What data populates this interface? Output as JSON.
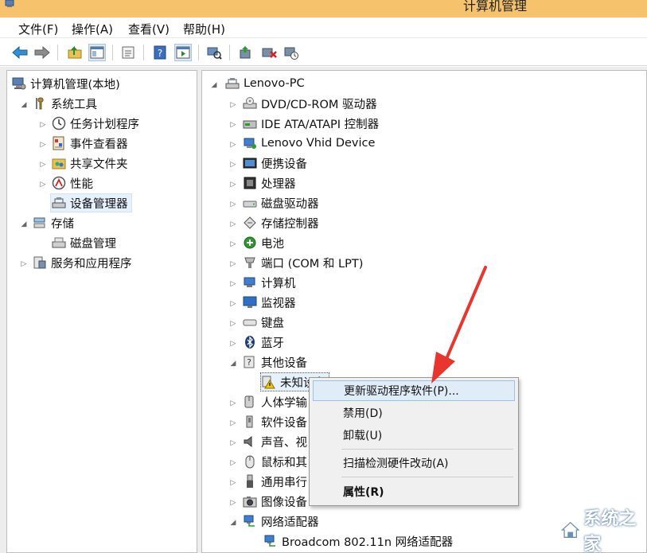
{
  "window": {
    "title": "计算机管理"
  },
  "menu": [
    "文件(F)",
    "操作(A)",
    "查看(V)",
    "帮助(H)"
  ],
  "left_tree": [
    {
      "label": "计算机管理(本地)",
      "icon": "computer-management-icon"
    },
    {
      "label": "系统工具",
      "icon": "tools-icon"
    },
    {
      "label": "任务计划程序",
      "icon": "clock-icon"
    },
    {
      "label": "事件查看器",
      "icon": "event-viewer-icon"
    },
    {
      "label": "共享文件夹",
      "icon": "shared-folder-icon"
    },
    {
      "label": "性能",
      "icon": "performance-icon"
    },
    {
      "label": "设备管理器",
      "icon": "device-manager-icon"
    },
    {
      "label": "存储",
      "icon": "storage-icon"
    },
    {
      "label": "磁盘管理",
      "icon": "disk-management-icon"
    },
    {
      "label": "服务和应用程序",
      "icon": "services-icon"
    }
  ],
  "right_tree": [
    {
      "label": "Lenovo-PC",
      "icon": "computer-icon"
    },
    {
      "label": "DVD/CD-ROM 驱动器",
      "icon": "dvd-icon"
    },
    {
      "label": "IDE ATA/ATAPI 控制器",
      "icon": "ide-icon"
    },
    {
      "label": "Lenovo Vhid Device",
      "icon": "hid-device-icon"
    },
    {
      "label": "便携设备",
      "icon": "portable-device-icon"
    },
    {
      "label": "处理器",
      "icon": "processor-icon"
    },
    {
      "label": "磁盘驱动器",
      "icon": "disk-drive-icon"
    },
    {
      "label": "存储控制器",
      "icon": "storage-controller-icon"
    },
    {
      "label": "电池",
      "icon": "battery-icon"
    },
    {
      "label": "端口 (COM 和 LPT)",
      "icon": "port-icon"
    },
    {
      "label": "计算机",
      "icon": "computer-icon"
    },
    {
      "label": "监视器",
      "icon": "monitor-icon"
    },
    {
      "label": "键盘",
      "icon": "keyboard-icon"
    },
    {
      "label": "蓝牙",
      "icon": "bluetooth-icon"
    },
    {
      "label": "其他设备",
      "icon": "other-devices-icon"
    },
    {
      "label": "未知设备",
      "icon": "unknown-device-warning-icon"
    },
    {
      "label": "人体学输",
      "icon": "hid-icon"
    },
    {
      "label": "软件设备",
      "icon": "software-device-icon"
    },
    {
      "label": "声音、视",
      "icon": "speaker-icon"
    },
    {
      "label": "鼠标和其",
      "icon": "mouse-icon"
    },
    {
      "label": "通用串行",
      "icon": "usb-icon"
    },
    {
      "label": "图像设备",
      "icon": "camera-icon"
    },
    {
      "label": "网络适配器",
      "icon": "network-adapter-icon"
    },
    {
      "label": "Broadcom 802.11n 网络适配器",
      "icon": "network-adapter-icon"
    }
  ],
  "context_menu": [
    {
      "label": "更新驱动程序软件(P)..."
    },
    {
      "label": "禁用(D)"
    },
    {
      "label": "卸载(U)"
    },
    {
      "label": "扫描检测硬件改动(A)"
    },
    {
      "label": "属性(R)"
    }
  ],
  "watermark": {
    "text": "系统之家"
  },
  "colors": {
    "titlebar": "#f6c26b",
    "selection": "#e5f1fb",
    "arrow": "#e8352e",
    "menu_bg": "#f0f0f0"
  }
}
